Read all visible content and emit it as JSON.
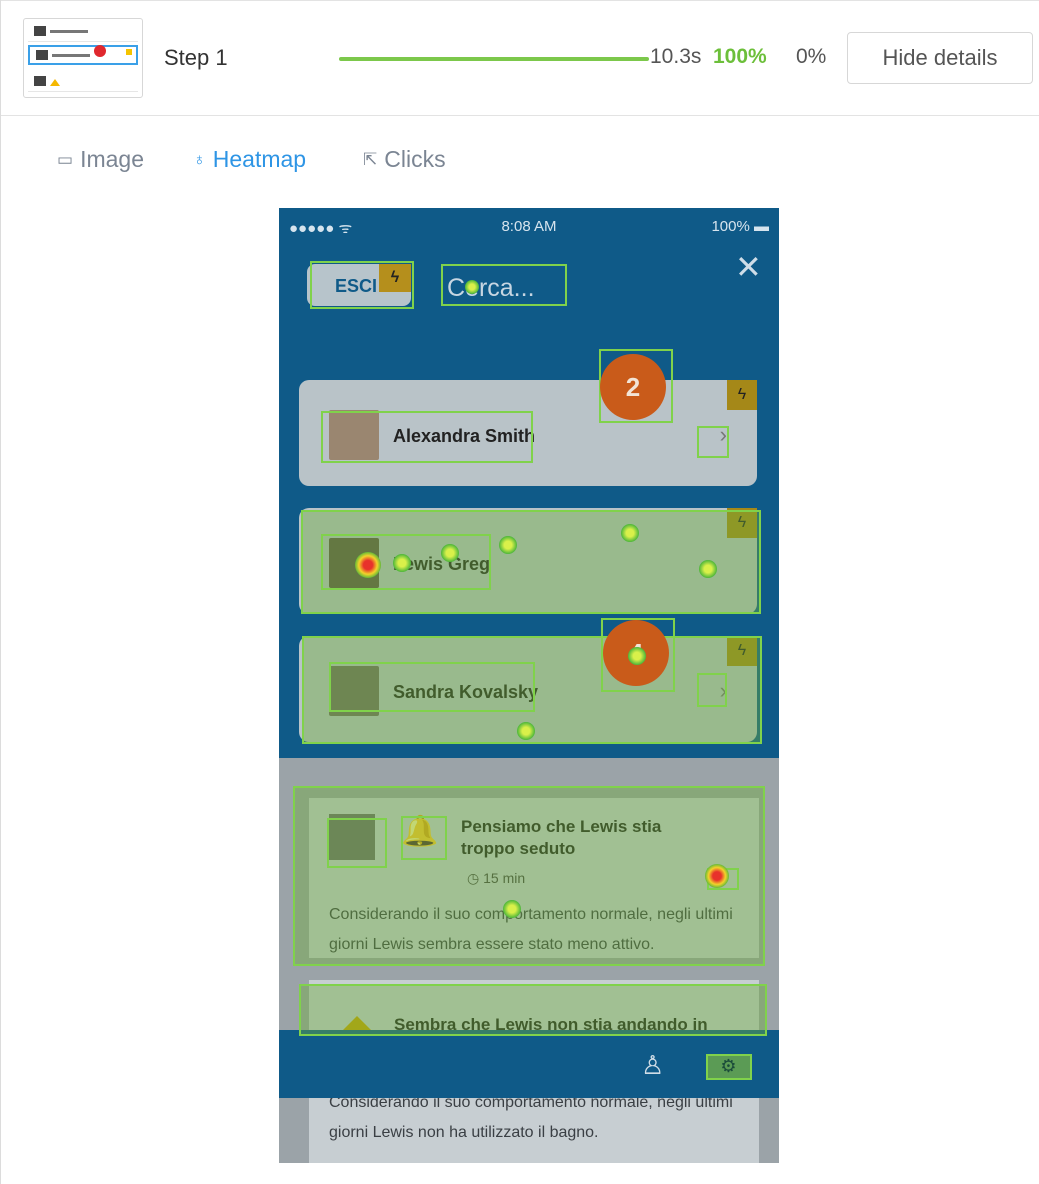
{
  "step": {
    "label": "Step 1",
    "progress": 1.0,
    "time": "10.3s",
    "success_pct": "100%",
    "fail_pct": "0%"
  },
  "header": {
    "hide_button": "Hide details"
  },
  "tabs": [
    {
      "label": "Image",
      "icon": "image-icon",
      "active": false
    },
    {
      "label": "Heatmap",
      "icon": "flame-icon",
      "active": true
    },
    {
      "label": "Clicks",
      "icon": "pointer-icon",
      "active": false
    }
  ],
  "phone": {
    "status": {
      "signal": "●●●●● ᯤ",
      "time": "8:08 AM",
      "battery": "100%"
    },
    "esci": "ESCI",
    "search_placeholder": "Cerca...",
    "contacts": [
      {
        "name": "Alexandra Smith"
      },
      {
        "name": "Lewis Greg"
      },
      {
        "name": "Sandra Kovalsky"
      }
    ],
    "notifications": [
      {
        "title": "Pensiamo che Lewis stia troppo seduto",
        "time": "15 min",
        "body": "Considerando il suo comportamento normale, negli ultimi giorni Lewis sembra essere stato meno attivo."
      },
      {
        "title": "Sembra che Lewis non stia andando in",
        "body": "Considerando il suo comportamento normale, negli ultimi giorni Lewis non ha utilizzato il bagno."
      }
    ],
    "click_counts": {
      "alexandra_top": "2",
      "sandra": "4"
    }
  },
  "colors": {
    "accent": "#2e95e5",
    "success": "#6cbf3a",
    "phone_bg": "#0f5a88",
    "box": "#80d24b"
  }
}
